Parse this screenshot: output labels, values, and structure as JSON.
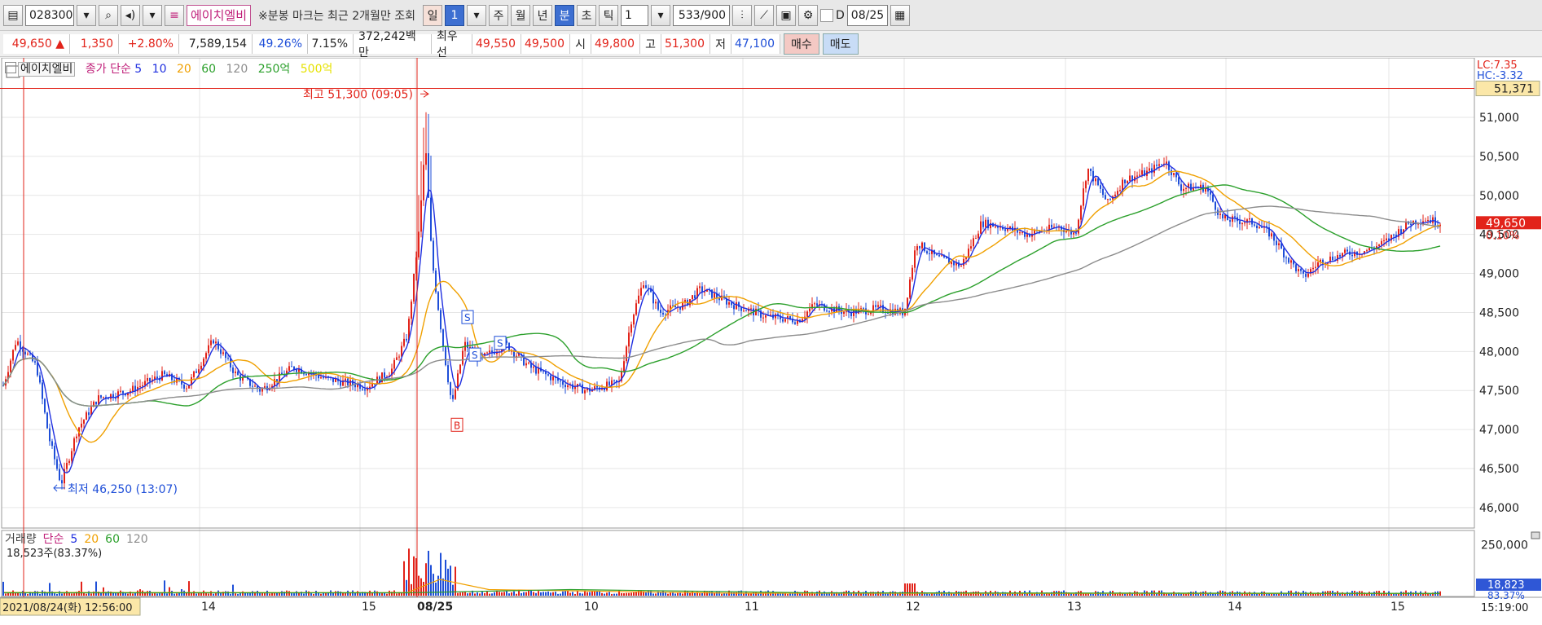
{
  "toolbar": {
    "code": "028300",
    "stock_name": "에이치엘비",
    "notice": "※분봉 마크는 최근 2개월만 조회",
    "periods": [
      "일",
      "1",
      "주",
      "월",
      "년",
      "분",
      "초",
      "틱"
    ],
    "interval": "1",
    "count": "533/900",
    "date_prefix": "D",
    "date": "08/25"
  },
  "quote": {
    "price": "49,650 ▲",
    "change": "1,350",
    "change_pct": "+2.80%",
    "volume": "7,589,154",
    "volume_ratio": "49.26%",
    "turnover": "7.15%",
    "amount": "372,242백만",
    "best_ask_label": "최우선",
    "best_ask": "49,550",
    "best_bid": "49,500",
    "open_label": "시",
    "open": "49,800",
    "high_label": "고",
    "high": "51,300",
    "low_label": "저",
    "low": "47,100",
    "buy_label": "매수",
    "sell_label": "매도"
  },
  "price_legend": {
    "name": "에이치엘비",
    "close_label": "종가",
    "simple_label": "단순",
    "ma": [
      "5",
      "10",
      "20",
      "60",
      "120"
    ],
    "ma_amt1": "250억",
    "ma_amt2": "500억"
  },
  "price_axis": {
    "lc": "LC:7.35",
    "hc": "HC:-3.32",
    "cursor_value": "51,371",
    "last_price": "49,650",
    "last_pct": "0.10%",
    "ticks": [
      "51,000",
      "50,500",
      "50,000",
      "49,500",
      "49,000",
      "48,500",
      "48,000",
      "47,500",
      "47,000",
      "46,500",
      "46,000"
    ]
  },
  "annotations": {
    "high": "최고 51,300 (09:05)",
    "low": "최저 46,250 (13:07)",
    "marks": [
      "S",
      "S",
      "S",
      "B"
    ]
  },
  "volume_legend": {
    "label": "거래량",
    "simple_label": "단순",
    "ma": [
      "5",
      "20",
      "60",
      "120"
    ],
    "current": "18,523주(83.37%)",
    "axis_tick": "250,000",
    "axis_value": "18,823",
    "axis_pct": "83.37%"
  },
  "time_axis": {
    "cursor": "2021/08/24(화) 12:56:00",
    "labels": [
      "14",
      "15",
      "08/25",
      "10",
      "11",
      "12",
      "13",
      "14",
      "15"
    ],
    "end": "15:19:00"
  },
  "colors": {
    "up": "#e2231a",
    "down": "#1f4fd8",
    "ma5": "#1f2fe0",
    "ma20": "#f0a000",
    "ma60": "#2ca02c",
    "ma120": "#8c8c8c"
  },
  "chart_data": {
    "type": "line",
    "title": "",
    "xlabel": "",
    "ylabel": "",
    "x": [
      "14",
      "15",
      "08/25",
      "10",
      "11",
      "12",
      "13",
      "14",
      "15"
    ],
    "ylim": [
      45800,
      51700
    ],
    "series": [
      {
        "name": "종가",
        "values": [
          47600,
          47550,
          50700,
          47900,
          48500,
          48450,
          49700,
          50100,
          49400,
          49650
        ]
      }
    ],
    "series_x": [
      0,
      1,
      2,
      2.5,
      3,
      4,
      5,
      6,
      7,
      8
    ],
    "annotations": [
      "최고 51,300 (09:05)",
      "최저 46,250 (13:07)"
    ],
    "volume_ylim": [
      0,
      300000
    ]
  }
}
